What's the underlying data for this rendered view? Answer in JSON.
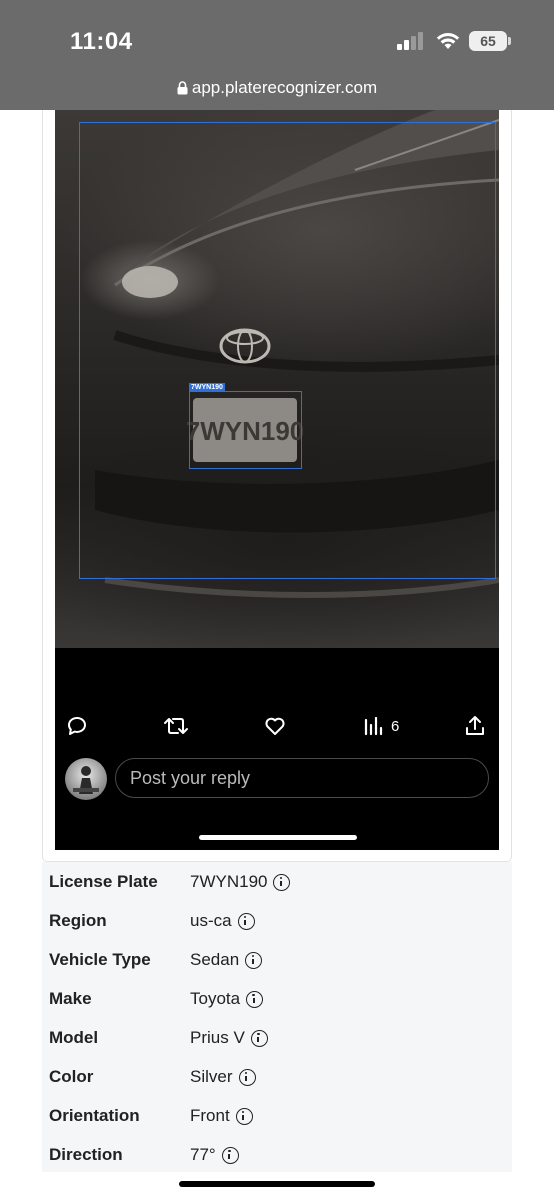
{
  "status_bar": {
    "time": "11:04",
    "battery": "65"
  },
  "browser": {
    "url": "app.platerecognizer.com"
  },
  "screenshot": {
    "plate_tag": "7WYN190",
    "views_count": "6",
    "reply_placeholder": "Post your reply"
  },
  "details": [
    {
      "label": "License Plate",
      "value": "7WYN190"
    },
    {
      "label": "Region",
      "value": "us-ca"
    },
    {
      "label": "Vehicle Type",
      "value": "Sedan"
    },
    {
      "label": "Make",
      "value": "Toyota"
    },
    {
      "label": "Model",
      "value": "Prius V"
    },
    {
      "label": "Color",
      "value": "Silver"
    },
    {
      "label": "Orientation",
      "value": "Front"
    },
    {
      "label": "Direction",
      "value": "77°"
    }
  ],
  "colors": {
    "status_bar_bg": "#6b6b6b",
    "detection_box": "#2f6fd6",
    "details_bg": "#f5f6f8"
  }
}
